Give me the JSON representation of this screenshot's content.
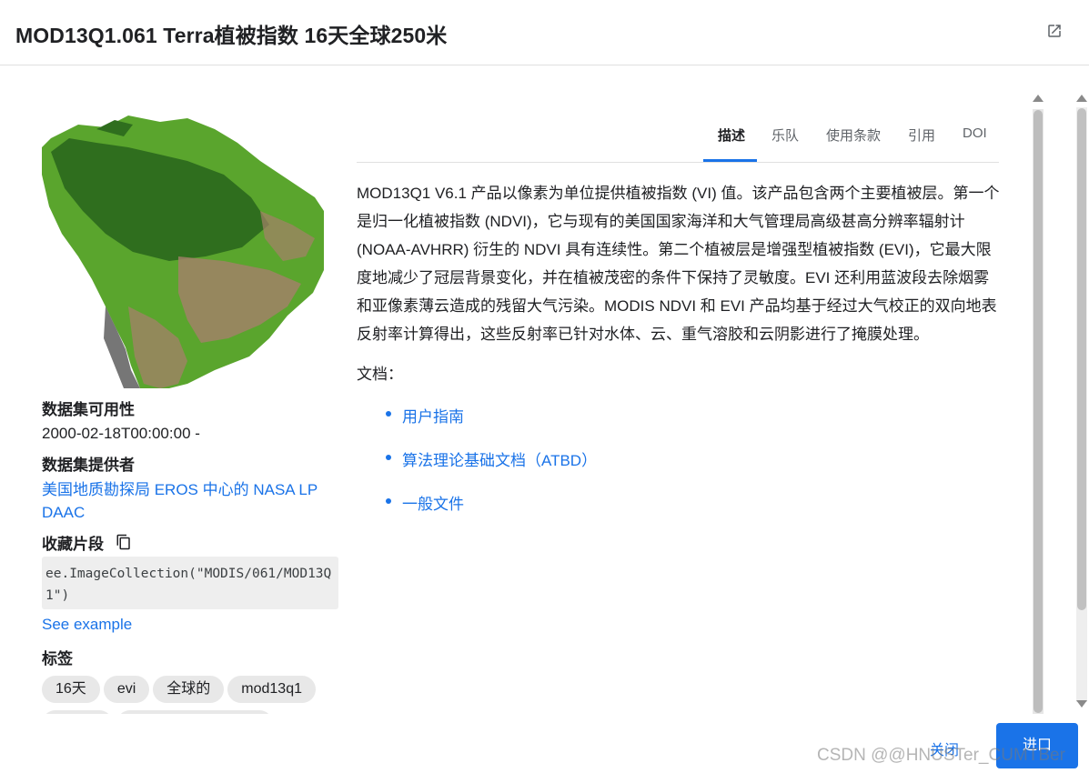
{
  "header": {
    "title": "MOD13Q1.061 Terra植被指数 16天全球250米"
  },
  "sidebar": {
    "availability_label": "数据集可用性",
    "availability_value": "2000-02-18T00:00:00 -",
    "provider_label": "数据集提供者",
    "provider_link": "美国地质勘探局 EROS 中心的 NASA LP DAAC",
    "snippet_label": "收藏片段",
    "snippet_code": "ee.ImageCollection(\"MODIS/061/MOD13Q1\")",
    "see_example": "See example",
    "tags_label": "标签",
    "tags": [
      "16天",
      "evi",
      "全球的",
      "mod13q1"
    ]
  },
  "tabs": [
    "描述",
    "乐队",
    "使用条款",
    "引用",
    "DOI"
  ],
  "main": {
    "description": "MOD13Q1 V6.1 产品以像素为单位提供植被指数 (VI) 值。该产品包含两个主要植被层。第一个是归一化植被指数 (NDVI)，它与现有的美国国家海洋和大气管理局高级甚高分辨率辐射计 (NOAA-AVHRR) 衍生的 NDVI 具有连续性。第二个植被层是增强型植被指数 (EVI)，它最大限度地减少了冠层背景变化，并在植被茂密的条件下保持了灵敏度。EVI 还利用蓝波段去除烟雾和亚像素薄云造成的残留大气污染。MODIS NDVI 和 EVI 产品均基于经过大气校正的双向地表反射率计算得出，这些反射率已针对水体、云、重气溶胶和云阴影进行了掩膜处理。",
    "docs_label": "文档：",
    "docs": [
      "用户指南",
      "算法理论基础文档（ATBD）",
      "一般文件"
    ]
  },
  "footer": {
    "close": "关闭",
    "import": "进口"
  },
  "watermark": "CSDN @@HNUSTer_CUMTBer",
  "colors": {
    "accent": "#1a73e8",
    "vegetation_dark": "#2f6e1e",
    "vegetation_light": "#5aa52d",
    "bare_land": "#a5806a"
  }
}
